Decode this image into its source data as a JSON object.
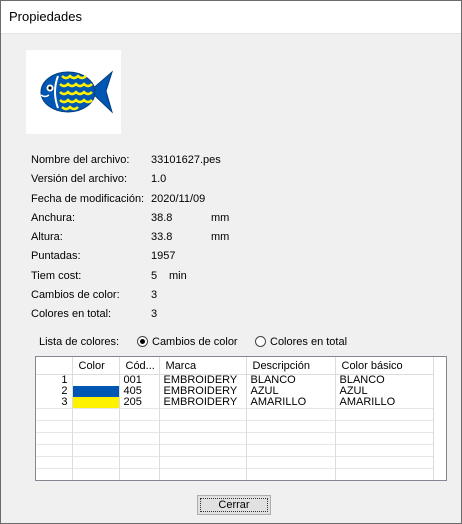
{
  "window": {
    "title": "Propiedades"
  },
  "thumbnail": {
    "icon": "fish-embroidery-icon",
    "colors": [
      "#0056b3",
      "#fff200"
    ]
  },
  "props": {
    "filename_label": "Nombre del archivo:",
    "filename": "33101627.pes",
    "version_label": "Versión del archivo:",
    "version": "1.0",
    "date_label": "Fecha de modificación:",
    "date": "2020/11/09",
    "width_label": "Anchura:",
    "width": "38.8",
    "width_unit": "mm",
    "height_label": "Altura:",
    "height": "33.8",
    "height_unit": "mm",
    "stitches_label": "Puntadas:",
    "stitches": "1957",
    "time_label": "Tiem cost:",
    "time": "5",
    "time_unit": "min",
    "changes_label": "Cambios de color:",
    "changes": "3",
    "total_label": "Colores en total:",
    "total": "3"
  },
  "list": {
    "label": "Lista de colores:",
    "option1": "Cambios de color",
    "option2": "Colores en total",
    "selected": "option1",
    "headers": [
      "",
      "Color",
      "Cód...",
      "Marca",
      "Descripción",
      "Color básico"
    ],
    "rows": [
      {
        "n": "1",
        "color": "#ffffff",
        "code": "001",
        "brand": "EMBROIDERY",
        "desc": "BLANCO",
        "basic": "BLANCO"
      },
      {
        "n": "2",
        "color": "#0056b3",
        "code": "405",
        "brand": "EMBROIDERY",
        "desc": "AZUL",
        "basic": "AZUL"
      },
      {
        "n": "3",
        "color": "#fff200",
        "code": "205",
        "brand": "EMBROIDERY",
        "desc": "AMARILLO",
        "basic": "AMARILLO"
      }
    ]
  },
  "close_button": "Cerrar"
}
